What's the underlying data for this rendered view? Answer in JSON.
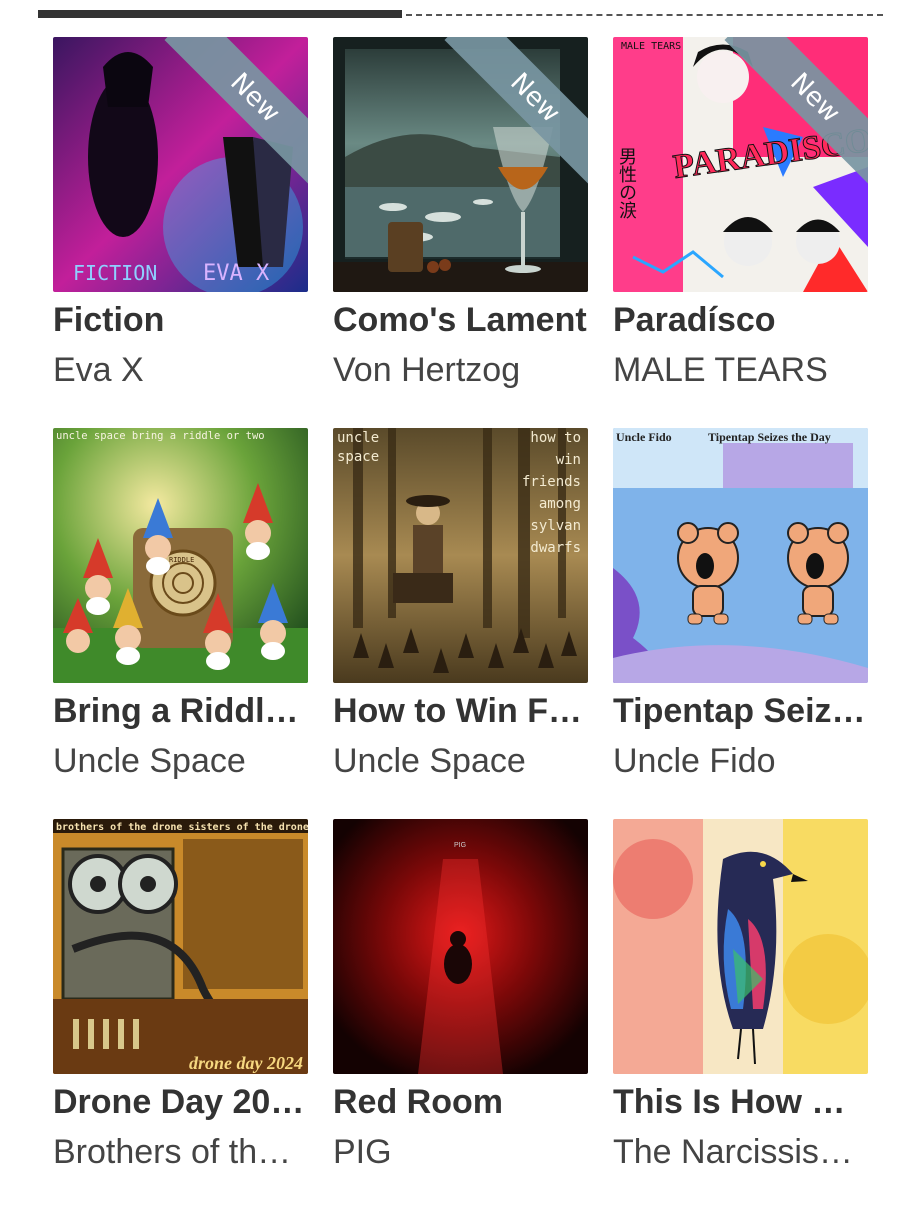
{
  "albums": [
    {
      "title": "Fiction",
      "artist": "Eva X",
      "badge": "New",
      "cover_text": [
        "FICTION",
        "EVA X"
      ]
    },
    {
      "title": "Como's Lament",
      "artist": "Von Hertzog",
      "badge": "New",
      "cover_text": []
    },
    {
      "title": "Paradísco",
      "artist": "MALE TEARS",
      "badge": "New",
      "cover_text": [
        "MALE TEARS",
        "PARADISCO",
        "男性の涙"
      ]
    },
    {
      "title": "Bring a Riddl…",
      "artist": "Uncle Space",
      "badge": "",
      "cover_text": [
        "uncle space  bring a riddle or two",
        "RIDDLE"
      ]
    },
    {
      "title": "How to Win F…",
      "artist": "Uncle Space",
      "badge": "",
      "cover_text": [
        "uncle",
        "space",
        "how to",
        "win",
        "friends",
        "among",
        "sylvan",
        "dwarfs"
      ]
    },
    {
      "title": "Tipentap Seiz…",
      "artist": "Uncle Fido",
      "badge": "",
      "cover_text": [
        "Uncle Fido",
        "Tipentap Seizes the Day"
      ]
    },
    {
      "title": "Drone Day 20…",
      "artist": "Brothers of th…",
      "badge": "",
      "cover_text": [
        "brothers of the drone  sisters of the drone",
        "drone day 2024"
      ]
    },
    {
      "title": "Red Room",
      "artist": "PIG",
      "badge": "",
      "cover_text": [
        "PIG"
      ]
    },
    {
      "title": "This Is How …",
      "artist": "The Narcissis…",
      "badge": "",
      "cover_text": []
    }
  ],
  "colors": {
    "ribbon": "#7896a2",
    "title": "#333333",
    "artist": "#444444"
  }
}
